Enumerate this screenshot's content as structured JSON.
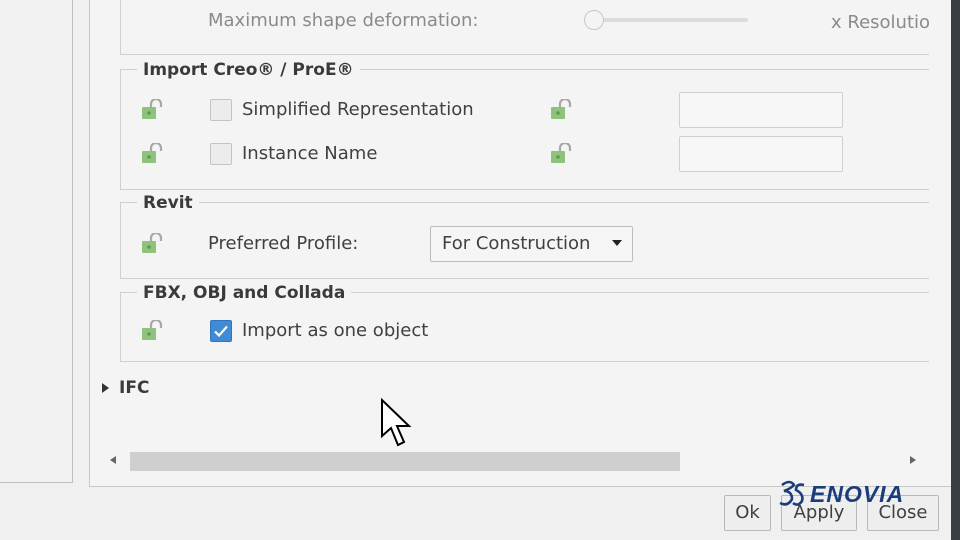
{
  "mesh_section": {
    "max_shape_deformation_label": "Maximum shape deformation:",
    "resolution_suffix": "x Resolutio"
  },
  "creo_group": {
    "title": "Import Creo® / ProE®",
    "simplified_rep_label": "Simplified Representation",
    "simplified_rep_checked": false,
    "simplified_rep_value": "",
    "instance_name_label": "Instance Name",
    "instance_name_checked": false,
    "instance_name_value": ""
  },
  "revit_group": {
    "title": "Revit",
    "preferred_profile_label": "Preferred Profile:",
    "preferred_profile_value": "For Construction"
  },
  "fbx_group": {
    "title": "FBX, OBJ and Collada",
    "import_one_object_label": "Import as one object",
    "import_one_object_checked": true
  },
  "ifc_section": {
    "title": "IFC",
    "expanded": false
  },
  "buttons": {
    "ok": "Ok",
    "apply": "Apply",
    "close": "Close"
  },
  "brand": {
    "name": "ENOVIA",
    "logo_icon": "3ds-logo-icon"
  },
  "colors": {
    "accent_checked": "#3f8bd6",
    "lock_icon": "#7fb86a",
    "brand": "#1b3d7a"
  }
}
